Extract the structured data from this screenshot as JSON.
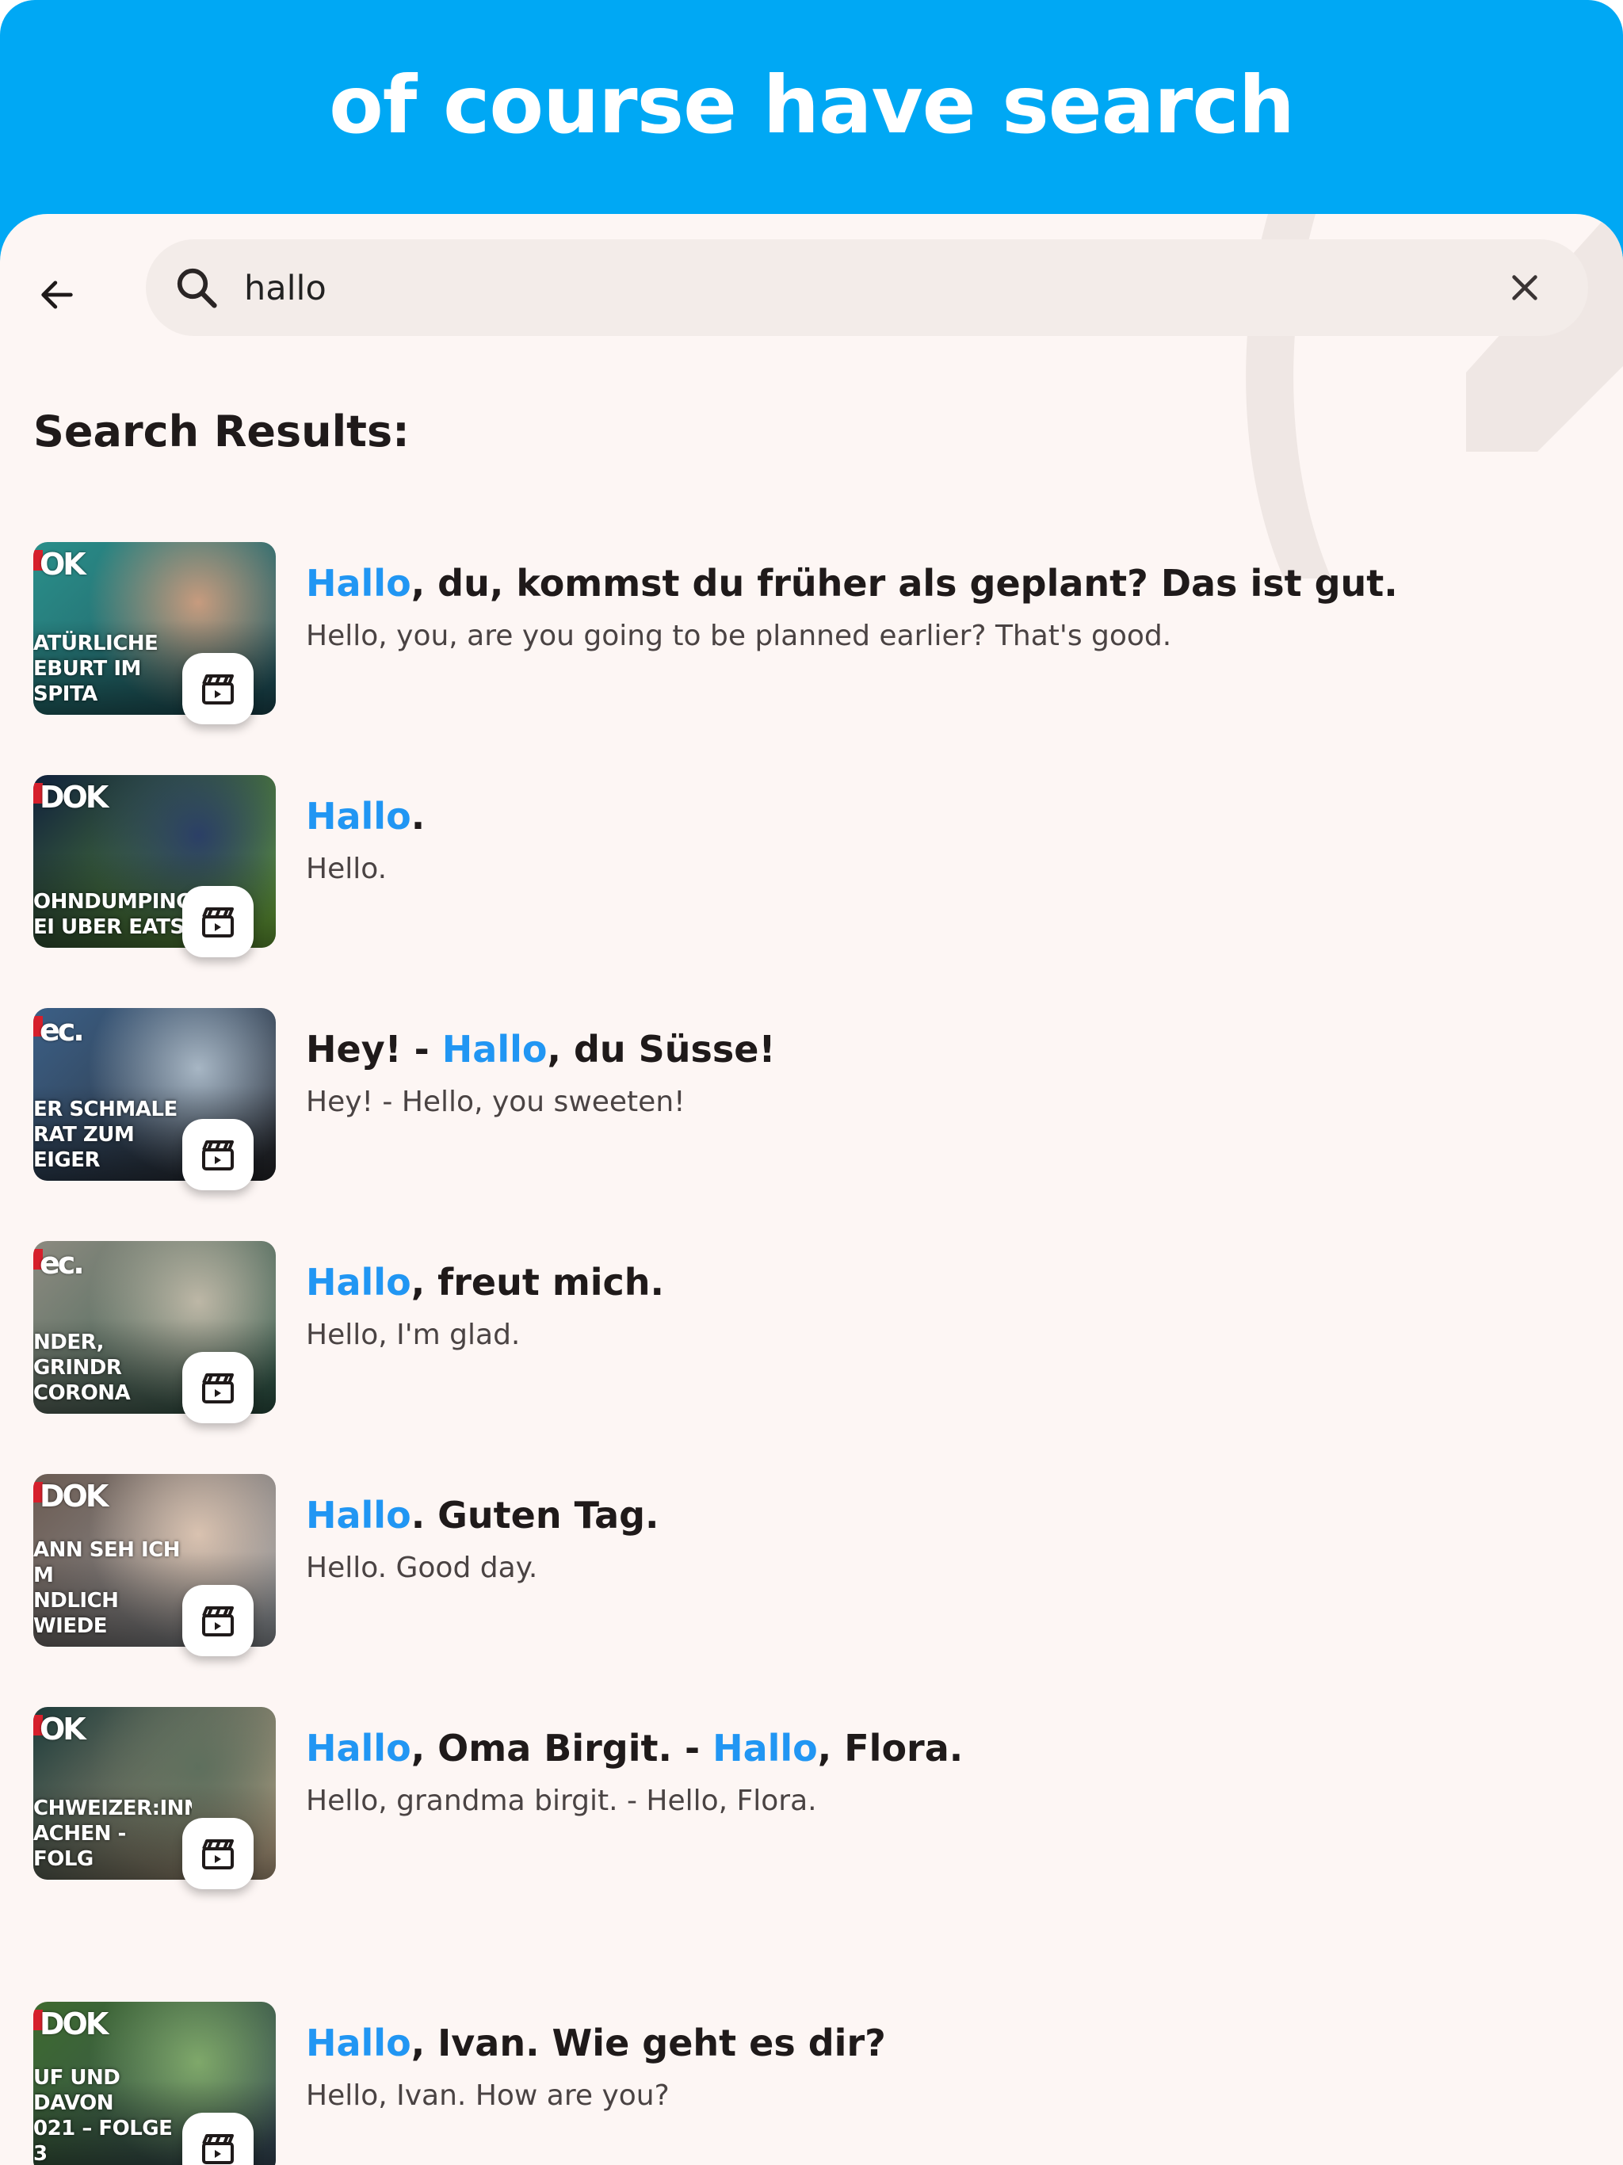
{
  "banner": {
    "title": "of course have search"
  },
  "search": {
    "query": "hallo"
  },
  "results_heading": "Search Results:",
  "results": [
    {
      "thumb": {
        "brand": "OK",
        "caption": "ATÜRLICHE\nEBURT IM SPITA",
        "colors": [
          "#2a8f8a",
          "#c79b7e",
          "#1f4f5a"
        ]
      },
      "sentence": {
        "highlight": "Hallo",
        "rest": ", du, kommst du früher als geplant? Das ist gut."
      },
      "translation": "Hello, you, are you going to be planned earlier? That's good."
    },
    {
      "thumb": {
        "brand": "DOK",
        "caption": "OHNDUMPING\nEI UBER EATS",
        "colors": [
          "#10203c",
          "#2b3f66",
          "#6fae3a"
        ]
      },
      "sentence": {
        "highlight": "Hallo",
        "rest": "."
      },
      "translation": "Hello."
    },
    {
      "thumb": {
        "brand": "ec.",
        "caption": "ER SCHMALE\nRAT ZUM EIGER",
        "colors": [
          "#3b5f86",
          "#a7b6c4",
          "#2a2a2e"
        ]
      },
      "sentence": {
        "prefix": "Hey! - ",
        "highlight": "Hallo",
        "rest": ", du Süsse!"
      },
      "translation": "Hey! - Hello, you sweeten!"
    },
    {
      "thumb": {
        "brand": "ec.",
        "caption": "NDER, GRINDR\nCORONA",
        "colors": [
          "#8c8a80",
          "#bdb7a6",
          "#2f5a4a"
        ]
      },
      "sentence": {
        "highlight": "Hallo",
        "rest": ", freut mich."
      },
      "translation": "Hello, I'm glad."
    },
    {
      "thumb": {
        "brand": "DOK",
        "caption": "ANN SEH ICH M\nNDLICH WIEDE",
        "colors": [
          "#6b5b52",
          "#d9c2b0",
          "#9aa0a6"
        ]
      },
      "sentence": {
        "highlight": "Hallo",
        "rest": ". Guten Tag."
      },
      "translation": "Hello. Good day."
    },
    {
      "thumb": {
        "brand": "OK",
        "caption": "CHWEIZER:INN\nACHEN - FOLG",
        "colors": [
          "#1d3b3a",
          "#5e6f5d",
          "#c9b08f"
        ]
      },
      "sentence": {
        "highlight": "Hallo",
        "rest": ", Oma Birgit. - ",
        "highlight2": "Hallo",
        "rest2": ", Flora."
      },
      "translation": "Hello, grandma birgit. - Hello, Flora."
    },
    {
      "thumb": {
        "brand": "DOK",
        "caption": "UF UND DAVON\n021 – FOLGE 3",
        "colors": [
          "#3d6a2e",
          "#7fa86a",
          "#394b5e"
        ]
      },
      "sentence": {
        "highlight": "Hallo",
        "rest": ", Ivan. Wie geht es dir?"
      },
      "translation": "Hello, Ivan. How are you?"
    }
  ],
  "colors": {
    "banner": "#00a8f4",
    "highlight": "#2196f3",
    "background": "#fdf6f4",
    "search_field": "#f3ece9"
  }
}
